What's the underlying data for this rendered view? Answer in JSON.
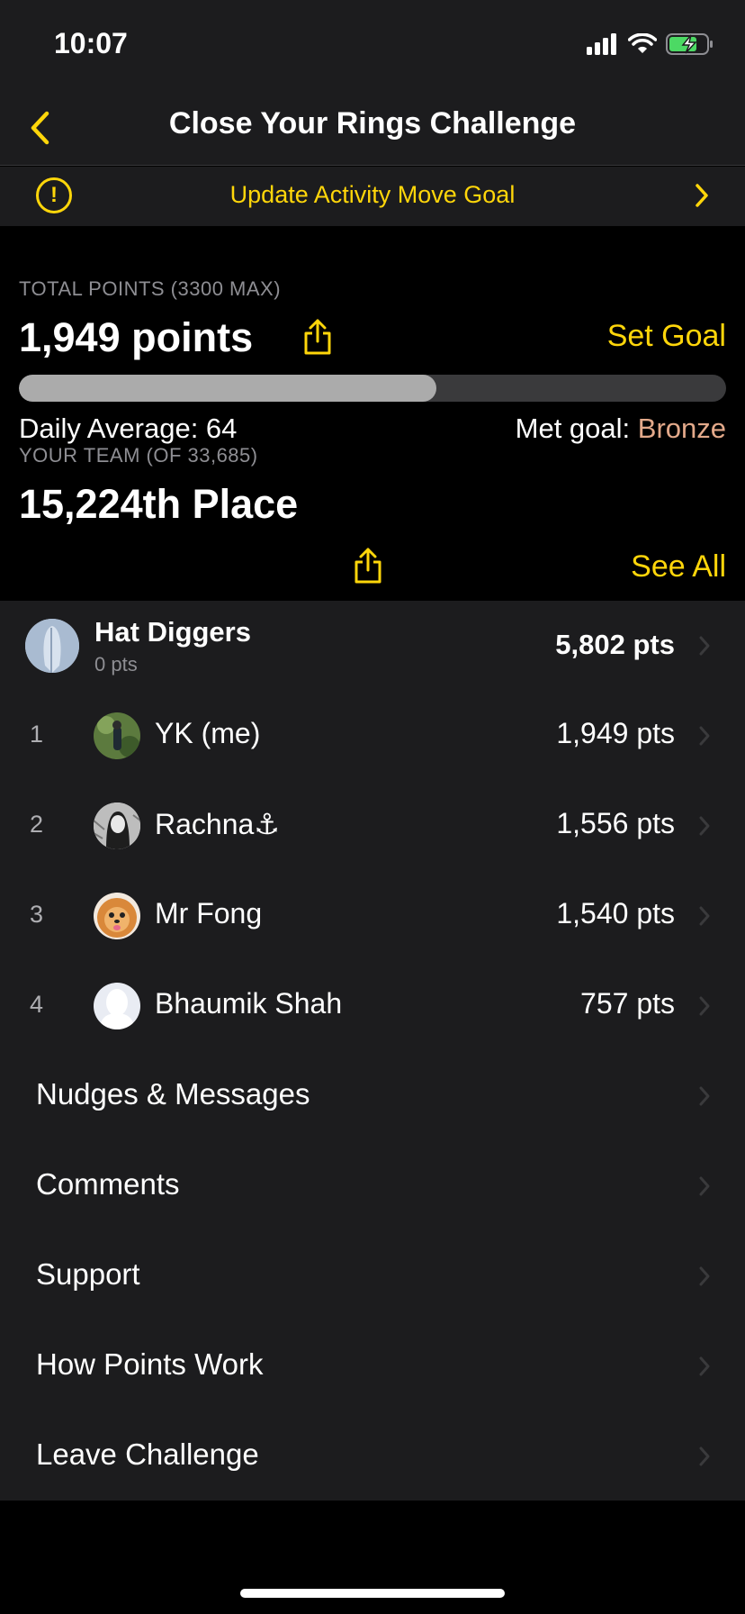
{
  "status_bar": {
    "time": "10:07"
  },
  "nav": {
    "title": "Close Your Rings Challenge"
  },
  "alert": {
    "text": "Update Activity Move Goal"
  },
  "points": {
    "label": "TOTAL POINTS (3300 MAX)",
    "value": "1,949 points",
    "set_goal": "Set Goal",
    "progress_fraction": 0.59,
    "daily_average": "Daily Average: 64",
    "met_goal_label": "Met goal: ",
    "met_goal_value": "Bronze"
  },
  "team": {
    "label": "YOUR TEAM (OF 33,685)",
    "place": "15,224th Place",
    "see_all": "See All",
    "name": "Hat Diggers",
    "sub": "0 pts",
    "points": "5,802 pts"
  },
  "members": [
    {
      "rank": "1",
      "name": "YK (me)",
      "points": "1,949 pts"
    },
    {
      "rank": "2",
      "name": "Rachna⚓︎",
      "points": "1,556 pts"
    },
    {
      "rank": "3",
      "name": "Mr Fong",
      "points": "1,540 pts"
    },
    {
      "rank": "4",
      "name": "Bhaumik Shah",
      "points": "757 pts"
    }
  ],
  "menu": [
    {
      "label": "Nudges & Messages"
    },
    {
      "label": "Comments"
    },
    {
      "label": "Support"
    },
    {
      "label": "How Points Work"
    },
    {
      "label": "Leave Challenge"
    }
  ],
  "colors": {
    "accent": "#ffd60a",
    "bronze": "#e3a98a",
    "row_bg": "#1c1c1e",
    "page_bg": "#000000"
  }
}
